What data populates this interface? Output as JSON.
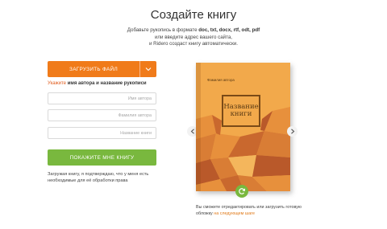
{
  "header": {
    "title": "Создайте книгу",
    "subtitle_1": "Добавьте рукопись в формате ",
    "formats": "doc, txt, docx, rtf, odt, pdf",
    "subtitle_2": "или введите адрес вашего сайта,",
    "subtitle_3": "и Ridero создаст книгу автоматически."
  },
  "form": {
    "upload_label": "ЗАГРУЗИТЬ ФАЙЛ",
    "hint_prefix": "Укажите ",
    "hint_bold": "имя автора и название рукописи",
    "first_name_placeholder": "Имя автора",
    "last_name_placeholder": "Фамилия автора",
    "book_title_placeholder": "Название книги",
    "show_button": "ПОКАЖИТЕ МНЕ КНИГУ",
    "terms": "Загружая книгу, я подтверждаю, что у меня есть необходимые для её обработки права"
  },
  "book": {
    "author": "Фамилия автора",
    "title_line_1": "Название",
    "title_line_2": "книги",
    "cover_color": "#f2a94b",
    "pattern_colors": [
      "#d97d35",
      "#b9592a",
      "#e7903c",
      "#c9682e",
      "#f4b65c"
    ]
  },
  "cover_note": {
    "text": "Вы сможете отредактировать или загрузить готовую обложку ",
    "link": "на следующем шаге"
  },
  "colors": {
    "accent_orange": "#f07b1a",
    "accent_green": "#79b83e"
  },
  "icons": {
    "caret": "chevron-down-icon",
    "prev": "chevron-left-icon",
    "next": "chevron-right-icon",
    "refresh": "refresh-icon"
  }
}
